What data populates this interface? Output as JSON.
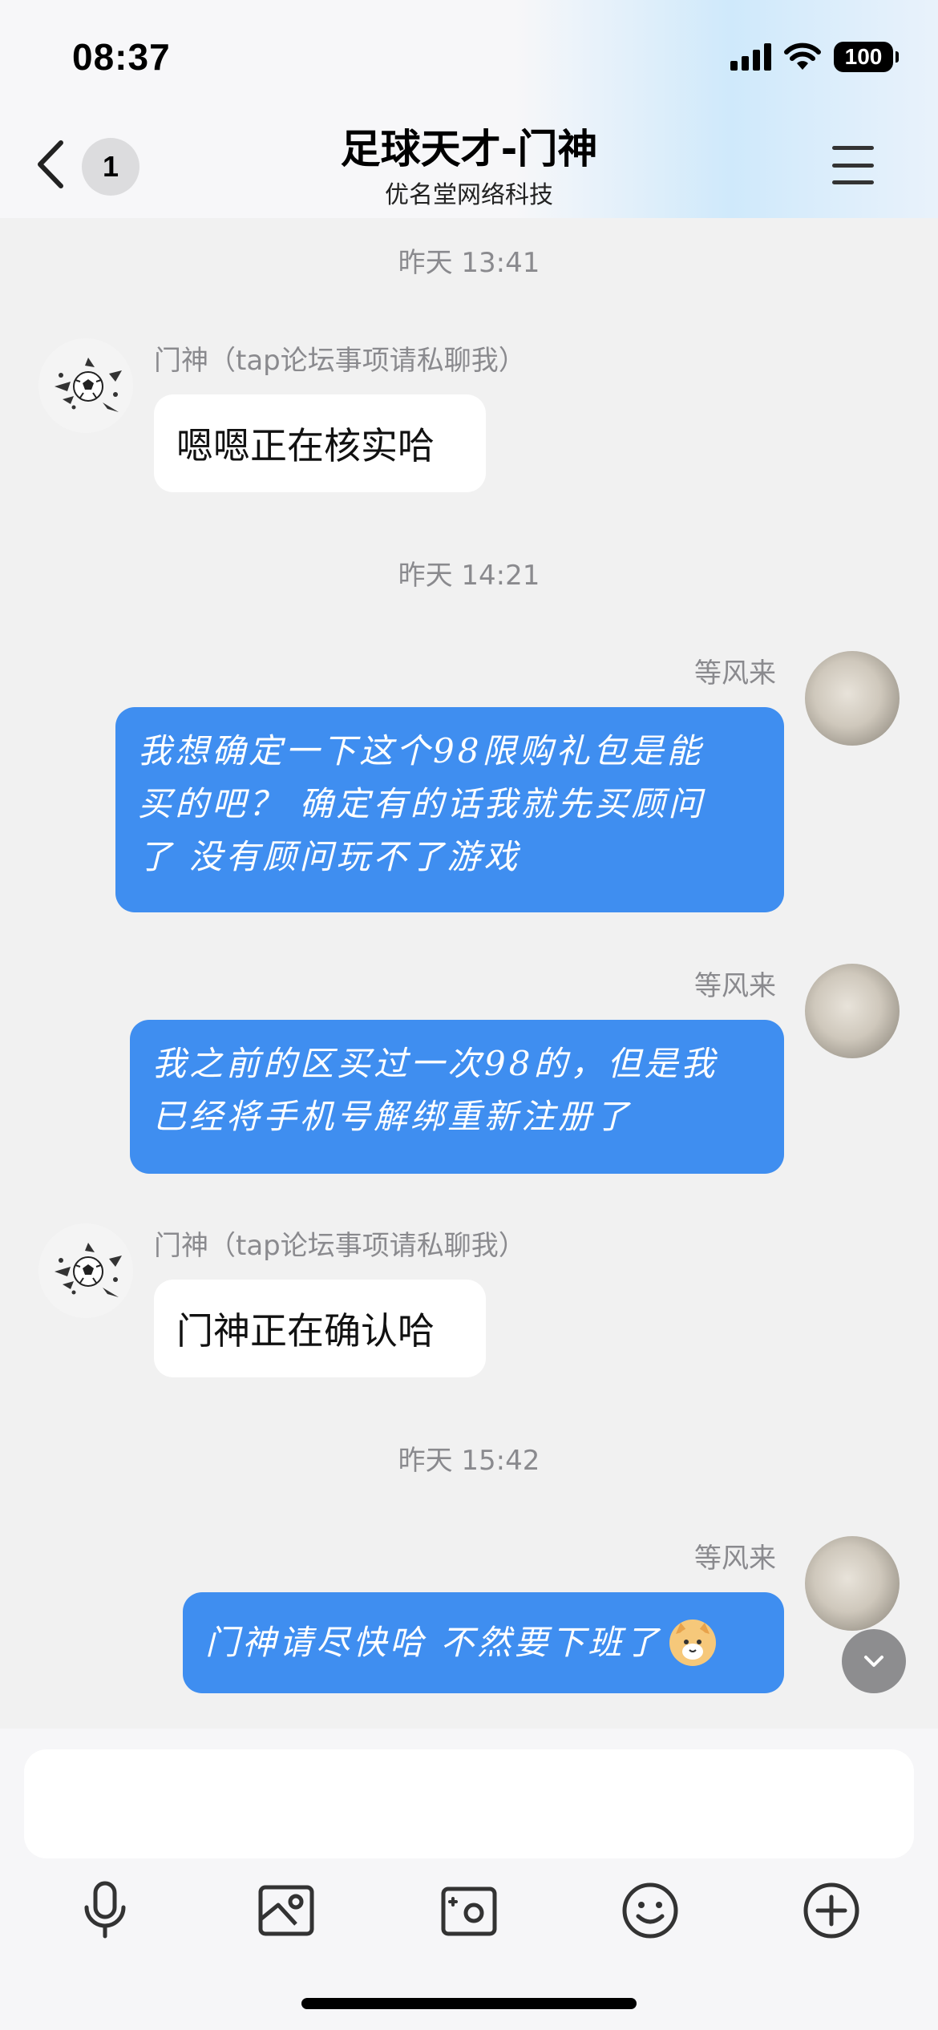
{
  "status_bar": {
    "time": "08:37",
    "battery": "100"
  },
  "header": {
    "badge_count": "1",
    "title": "足球天才-门神",
    "subtitle": "优名堂网络科技"
  },
  "messages": [
    {
      "type": "timestamp",
      "text": "昨天 13:41"
    },
    {
      "type": "incoming",
      "sender": "门神（tap论坛事项请私聊我）",
      "text": "嗯嗯正在核实哈"
    },
    {
      "type": "timestamp",
      "text": "昨天 14:21"
    },
    {
      "type": "outgoing",
      "sender": "等风来",
      "lines": [
        "我想确定一下这个98限购礼包是能",
        "买的吧？ 确定有的话我就先买顾问",
        "了 没有顾问玩不了游戏"
      ]
    },
    {
      "type": "outgoing",
      "sender": "等风来",
      "lines": [
        "我之前的区买过一次98的，但是我",
        "已经将手机号解绑重新注册了"
      ]
    },
    {
      "type": "incoming",
      "sender": "门神（tap论坛事项请私聊我）",
      "text": "门神正在确认哈"
    },
    {
      "type": "timestamp",
      "text": "昨天 15:42"
    },
    {
      "type": "outgoing",
      "sender": "等风来",
      "text": "门神请尽快哈 不然要下班了",
      "emoji": "cat-face-emoji"
    }
  ],
  "input": {
    "placeholder": ""
  },
  "toolbar": [
    "microphone-icon",
    "image-icon",
    "camera-icon",
    "emoji-icon",
    "plus-icon"
  ],
  "colors": {
    "outgoing_bubble": "#3f8ef0",
    "incoming_bubble": "#ffffff",
    "background": "#f1f1f1"
  }
}
